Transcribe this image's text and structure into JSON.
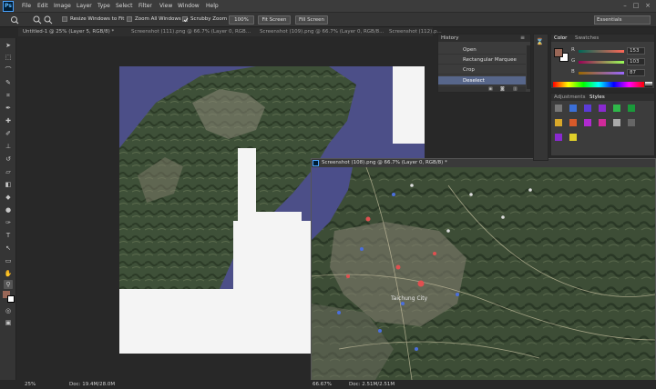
{
  "app": {
    "logo": "Ps"
  },
  "menu": [
    "File",
    "Edit",
    "Image",
    "Layer",
    "Type",
    "Select",
    "Filter",
    "View",
    "Window",
    "Help"
  ],
  "window_controls": [
    "–",
    "□",
    "×"
  ],
  "options": {
    "zoom_in_icon": "+",
    "zoom_out_icon": "−",
    "resize_label": "Resize Windows to Fit",
    "zoom_all_label": "Zoom All Windows",
    "scrubby_label": "Scrubby Zoom",
    "pct_btn": "100%",
    "fit_btn": "Fit Screen",
    "fill_btn": "Fill Screen",
    "workspace": "Essentials"
  },
  "tabs": [
    "Untitled-1 @ 25% (Layer 5, RGB/8) *",
    "Screenshot (111).png @ 66.7% (Layer 0, RGB...",
    "Screenshot (109).png @ 66.7% (Layer 0, RGB/8...",
    "Screenshot (112).p..."
  ],
  "float_doc": {
    "title": "Screenshot (108).png @ 66.7% (Layer 0, RGB/8) *",
    "status_zoom": "66.67%",
    "status_doc": "Doc: 2.51M/2.51M"
  },
  "main_status": {
    "zoom": "25%",
    "doc": "Doc: 19.4M/28.0M"
  },
  "history": {
    "title": "History",
    "items": [
      "Open",
      "Rectangular Marquee",
      "Crop",
      "Deselect"
    ]
  },
  "color_panel": {
    "tabs": [
      "Color",
      "Swatches"
    ],
    "r_label": "R",
    "g_label": "G",
    "b_label": "B",
    "r": "153",
    "g": "103",
    "b": "87"
  },
  "adjust_panel": {
    "tabs": [
      "Adjustments",
      "Styles"
    ]
  },
  "map_label": "Taichung City",
  "colors": {
    "fg": "#996757",
    "bg": "#ffffff",
    "accent": "#4aa3ff"
  }
}
